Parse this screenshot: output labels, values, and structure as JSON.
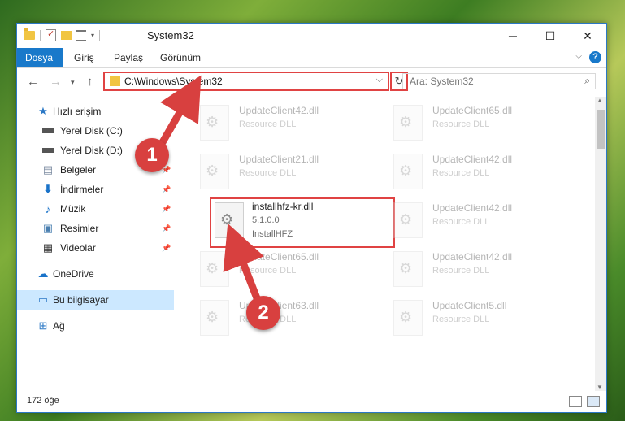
{
  "window": {
    "title": "System32"
  },
  "ribbon": {
    "tabs": [
      "Dosya",
      "Giriş",
      "Paylaş",
      "Görünüm"
    ],
    "help": "?"
  },
  "nav": {
    "address": "C:\\Windows\\System32",
    "search_placeholder": "Ara: System32"
  },
  "sidebar": {
    "items": [
      {
        "label": "Hızlı erişim",
        "icon": "star-icon",
        "pinned": false
      },
      {
        "label": "Yerel Disk (C:)",
        "icon": "drive-icon",
        "pinned": false
      },
      {
        "label": "Yerel Disk (D:)",
        "icon": "drive-icon",
        "pinned": false
      },
      {
        "label": "Belgeler",
        "icon": "documents-icon",
        "pinned": true
      },
      {
        "label": "İndirmeler",
        "icon": "download-icon",
        "pinned": true
      },
      {
        "label": "Müzik",
        "icon": "music-icon",
        "pinned": true
      },
      {
        "label": "Resimler",
        "icon": "pictures-icon",
        "pinned": true
      },
      {
        "label": "Videolar",
        "icon": "videos-icon",
        "pinned": true
      },
      {
        "label": "OneDrive",
        "icon": "cloud-icon",
        "pinned": false
      },
      {
        "label": "Bu bilgisayar",
        "icon": "computer-icon",
        "pinned": false
      },
      {
        "label": "Ağ",
        "icon": "network-icon",
        "pinned": false
      }
    ]
  },
  "files": [
    {
      "name": "UpdateClient42.dll",
      "line2": "Resource DLL",
      "line3": ""
    },
    {
      "name": "UpdateClient65.dll",
      "line2": "Resource DLL",
      "line3": ""
    },
    {
      "name": "UpdateClient21.dll",
      "line2": "Resource DLL",
      "line3": ""
    },
    {
      "name": "UpdateClient42.dll",
      "line2": "Resource DLL",
      "line3": ""
    },
    {
      "name": "installhfz-kr.dll",
      "line2": "5.1.0.0",
      "line3": "InstallHFZ"
    },
    {
      "name": "UpdateClient42.dll",
      "line2": "Resource DLL",
      "line3": ""
    },
    {
      "name": "UpdateClient65.dll",
      "line2": "Resource DLL",
      "line3": ""
    },
    {
      "name": "UpdateClient42.dll",
      "line2": "Resource DLL",
      "line3": ""
    },
    {
      "name": "UpdateClient63.dll",
      "line2": "Resource DLL",
      "line3": ""
    },
    {
      "name": "UpdateClient5.dll",
      "line2": "Resource DLL",
      "line3": ""
    }
  ],
  "status": {
    "count": "172 öğe"
  },
  "annotations": {
    "step1": "1",
    "step2": "2",
    "color": "#d8403f"
  }
}
